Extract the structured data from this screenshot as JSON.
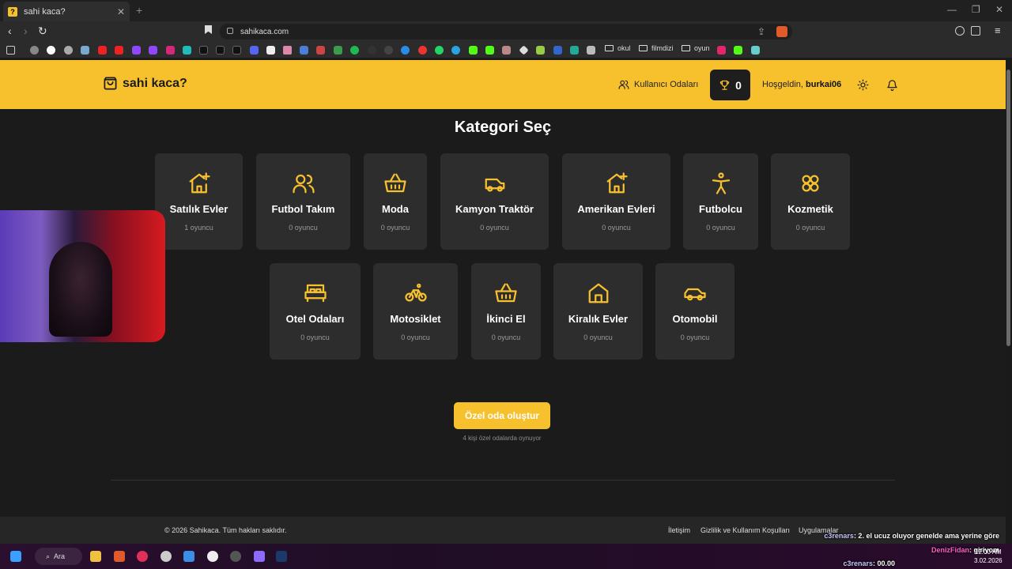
{
  "browser": {
    "tab_title": "sahi kaca?",
    "tab_favicon": "?",
    "url": "sahikaca.com",
    "bookmark_folders": [
      "okul",
      "filmdizi",
      "oyun"
    ]
  },
  "header": {
    "logo_text": "sahi kaca?",
    "rooms_link": "Kullanıcı Odaları",
    "trophy_count": "0",
    "welcome_prefix": "Hoşgeldin,",
    "username": "burkai06"
  },
  "main": {
    "title": "Kategori Seç",
    "categories": [
      {
        "name": "Satılık Evler",
        "count": "1 oyuncu",
        "icon": "house-plus-icon"
      },
      {
        "name": "Futbol Takım",
        "count": "0 oyuncu",
        "icon": "users-icon"
      },
      {
        "name": "Moda",
        "count": "0 oyuncu",
        "icon": "basket-icon"
      },
      {
        "name": "Kamyon Traktör",
        "count": "0 oyuncu",
        "icon": "truck-icon"
      },
      {
        "name": "Amerikan Evleri",
        "count": "0 oyuncu",
        "icon": "house-plus-icon"
      },
      {
        "name": "Futbolcu",
        "count": "0 oyuncu",
        "icon": "person-icon"
      },
      {
        "name": "Kozmetik",
        "count": "0 oyuncu",
        "icon": "flower-icon"
      },
      {
        "name": "Otel Odaları",
        "count": "0 oyuncu",
        "icon": "bed-icon"
      },
      {
        "name": "Motosiklet",
        "count": "0 oyuncu",
        "icon": "bicycle-icon"
      },
      {
        "name": "İkinci El",
        "count": "0 oyuncu",
        "icon": "basket-icon"
      },
      {
        "name": "Kiralık Evler",
        "count": "0 oyuncu",
        "icon": "house-icon"
      },
      {
        "name": "Otomobil",
        "count": "0 oyuncu",
        "icon": "car-icon"
      }
    ],
    "create_button": "Özel oda oluştur",
    "private_note": "4 kişi özel odalarda oynuyor"
  },
  "footer": {
    "copyright": "© 2026 Sahikaca. Tüm hakları saklıdır.",
    "links": [
      "İletişim",
      "Gizlilik ve Kullanım Koşulları",
      "Uygulamalar"
    ]
  },
  "chat": [
    {
      "user": "c3renars",
      "message": ": 2. el ucuz oluyor genelde ama yerine göre"
    },
    {
      "user": "DenizFidan",
      "message": ": giriyom"
    },
    {
      "user": "c3renars",
      "message": ": 00.00"
    }
  ],
  "taskbar": {
    "search_label": "Ara",
    "time": "12:00 AM",
    "date": "3.02.2026"
  },
  "colors": {
    "accent": "#f7c02d",
    "background": "#1b1b1b",
    "card": "#2d2d2d"
  }
}
